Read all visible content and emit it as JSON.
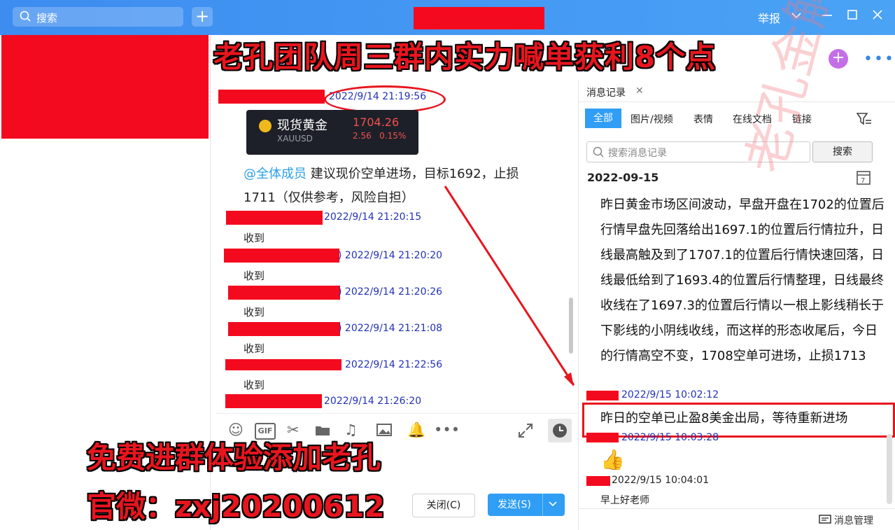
{
  "titlebar": {
    "search_placeholder": "搜索",
    "report": "举报"
  },
  "headline": "老孔团队周三群内实力喊单获利8个点",
  "chat": {
    "first_timestamp": "2022/9/14 21:19:56",
    "gold_card": {
      "name": "现货黄金",
      "price": "1704.26",
      "code": "XAUUSD",
      "change": "2.56",
      "change_pct": "0.15%"
    },
    "announce_mention": "@全体成员",
    "announce_line1": " 建议现价空单进场，目标1692，止损",
    "announce_line2": "1711（仅供参考，风险自担）",
    "replies": [
      {
        "ts": "2022/9/14 21:20:15",
        "text": "收到"
      },
      {
        "ts": ") 2022/9/14 21:20:20",
        "text": "收到"
      },
      {
        "ts": ") 2022/9/14 21:20:26",
        "text": "收到"
      },
      {
        "ts": ") 2022/9/14 21:21:08",
        "text": "收到"
      },
      {
        "ts": "2022/9/14 21:22:56",
        "text": "收到"
      },
      {
        "ts": "2022/9/14 21:26:20",
        "text": ""
      }
    ]
  },
  "promo": {
    "line1": "免费进群体验添加老孔",
    "line2": "官微：zxj20200612"
  },
  "buttons": {
    "close": "关闭(C)",
    "send": "发送(S)"
  },
  "right_panel": {
    "title": "消息记录",
    "tabs": [
      "全部",
      "图片/视频",
      "表情",
      "在线文档",
      "链接"
    ],
    "search_placeholder": "搜索消息记录",
    "search_button": "搜索",
    "date": "2022-09-15",
    "long_message": "昨日黄金市场区间波动，早盘开盘在1702的位置后行情早盘先回落给出1697.1的位置后行情拉升，日线最高触及到了1707.1的位置后行情快速回落，日线最低给到了1693.4的位置后行情整理，日线最终收线在了1697.3的位置后行情以一根上影线稍长于下影线的小阴线收线，而这样的形态收尾后，今日的行情高空不变，1708空单可进场，止损1713",
    "entries": [
      {
        "ts": "2022/9/15 10:02:12",
        "text": "昨日的空单已止盈8美金出局，等待重新进场"
      },
      {
        "ts": "2022/9/15 10:03:28",
        "text": "👍"
      },
      {
        "ts": "2022/9/15 10:04:01",
        "text": "早上好老师"
      }
    ],
    "footer": "消息管理"
  },
  "watermark": "老孔金解"
}
